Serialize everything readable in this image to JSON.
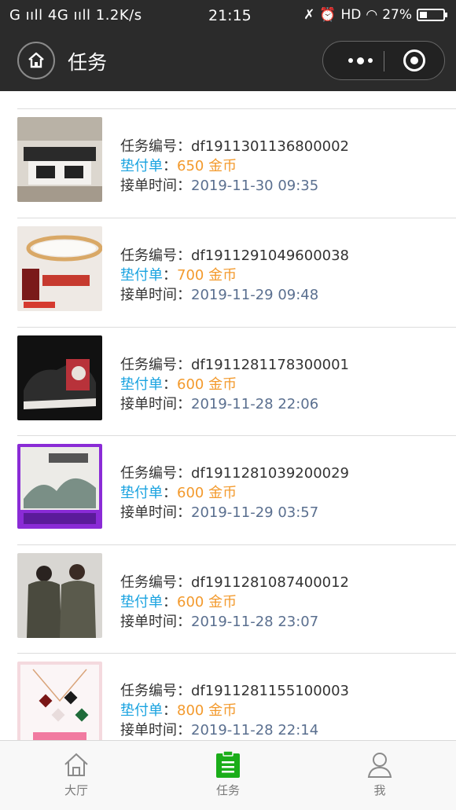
{
  "status_bar": {
    "left": "G ııll 4G ııll 1.2K/s",
    "time": "21:15",
    "right": "HD",
    "battery": "27%"
  },
  "nav": {
    "title": "任务"
  },
  "labels": {
    "task_no": "任务编号：",
    "order_type": "垫付单",
    "colon": "：",
    "time": "接单时间："
  },
  "tasks": [
    {
      "id": "df1911301136800002",
      "coins": "650 金币",
      "time": "2019-11-30 09:35",
      "thumb": "coffee-table"
    },
    {
      "id": "df1911291049600038",
      "coins": "700 金币",
      "time": "2019-11-29 09:48",
      "thumb": "ceiling-lamp"
    },
    {
      "id": "df1911281178300001",
      "coins": "600 金币",
      "time": "2019-11-28 22:06",
      "thumb": "sneakers"
    },
    {
      "id": "df1911281039200029",
      "coins": "600 金币",
      "time": "2019-11-29 03:57",
      "thumb": "wall-painting"
    },
    {
      "id": "df1911281087400012",
      "coins": "600 金币",
      "time": "2019-11-28 23:07",
      "thumb": "winter-coats"
    },
    {
      "id": "df1911281155100003",
      "coins": "800 金币",
      "time": "2019-11-28 22:14",
      "thumb": "necklace"
    }
  ],
  "tabbar": [
    {
      "label": "大厅",
      "icon": "home-icon",
      "active": false
    },
    {
      "label": "任务",
      "icon": "clipboard-icon",
      "active": true
    },
    {
      "label": "我",
      "icon": "user-icon",
      "active": false
    }
  ],
  "colors": {
    "header_bg": "#2b2b2b",
    "blue_label": "#1aa3e0",
    "orange_value": "#f39a2d",
    "date_value": "#5a6f8f",
    "active_tab": "#1aad19"
  }
}
